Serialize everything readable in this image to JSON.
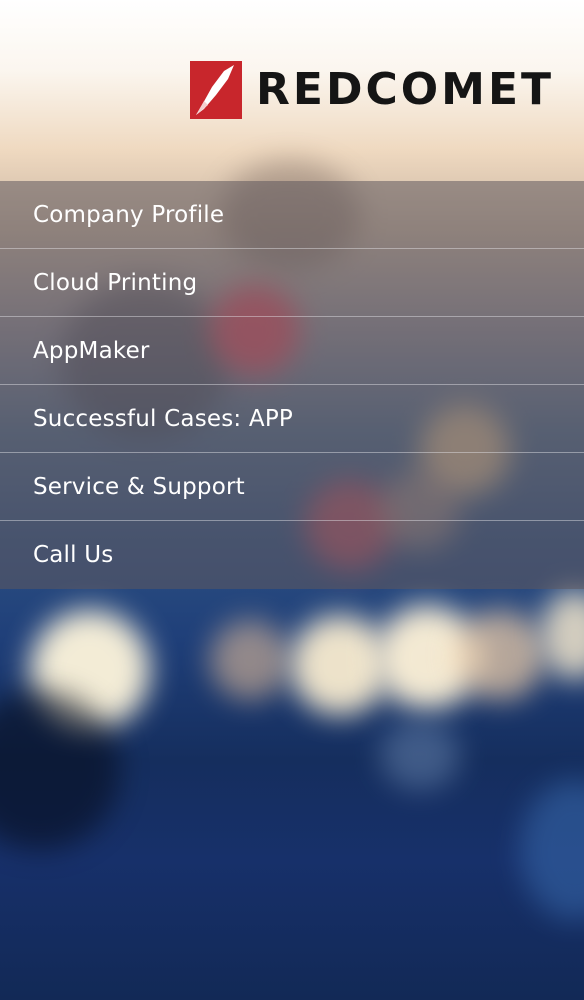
{
  "brand": {
    "name": "REDCOMET",
    "logo_icon": "red-comet-logo-icon",
    "logo_color": "#c8262c"
  },
  "menu": {
    "items": [
      {
        "label": "Company Profile"
      },
      {
        "label": "Cloud Printing"
      },
      {
        "label": "AppMaker"
      },
      {
        "label": "Successful Cases: APP"
      },
      {
        "label": "Service & Support"
      },
      {
        "label": "Call Us"
      }
    ]
  }
}
